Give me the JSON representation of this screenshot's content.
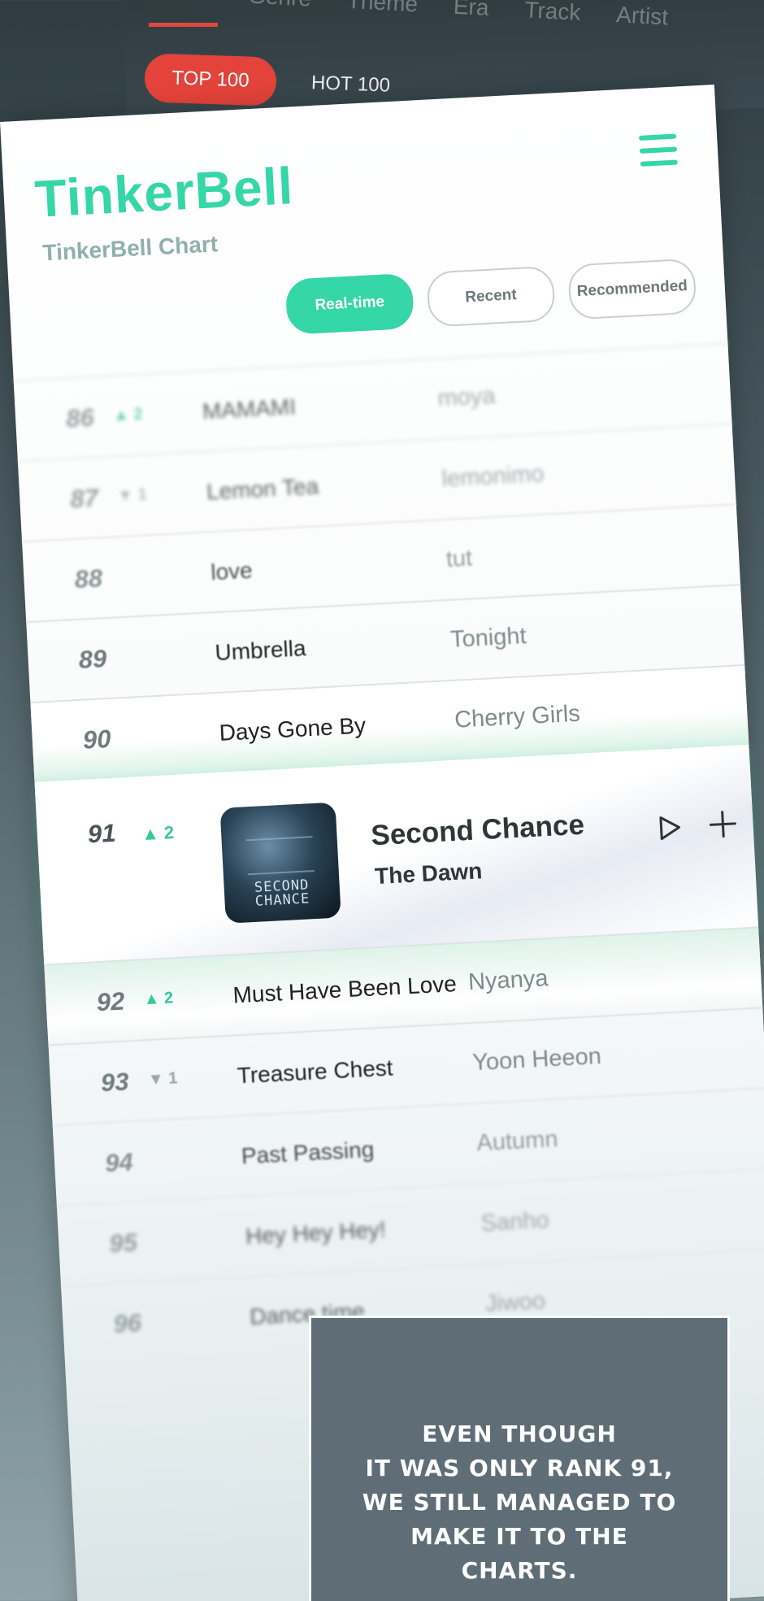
{
  "background_app": {
    "nav_items": [
      "Genre",
      "Theme",
      "Era",
      "Track",
      "Artist"
    ],
    "active_tab": "TOP 100",
    "other_tab": "HOT 100",
    "accent_color": "#e3433a"
  },
  "app": {
    "logo": "TinkerBell",
    "subtitle": "TinkerBell Chart",
    "brand_color": "#35d6a8",
    "menu_icon": "hamburger-menu-icon"
  },
  "tabs": [
    {
      "label": "Real-time",
      "active": true
    },
    {
      "label": "Recent",
      "active": false
    },
    {
      "label": "Recommended",
      "active": false
    }
  ],
  "chart": {
    "rows_before": [
      {
        "rank": "86",
        "delta": "▲ 2",
        "direction": "up",
        "title": "MAMAMI",
        "artist": "moya"
      },
      {
        "rank": "87",
        "delta": "▼ 1",
        "direction": "down",
        "title": "Lemon Tea",
        "artist": "lemonimo"
      },
      {
        "rank": "88",
        "delta": "",
        "direction": "none",
        "title": "love",
        "artist": "tut"
      },
      {
        "rank": "89",
        "delta": "",
        "direction": "none",
        "title": "Umbrella",
        "artist": "Tonight"
      },
      {
        "rank": "90",
        "delta": "",
        "direction": "none",
        "title": "Days Gone By",
        "artist": "Cherry Girls"
      }
    ],
    "featured": {
      "rank": "91",
      "delta": "▲ 2",
      "direction": "up",
      "title": "Second Chance",
      "artist": "The Dawn",
      "cover_text": "SECOND CHANCE",
      "play_icon": "play-icon",
      "add_icon": "plus-icon"
    },
    "rows_after": [
      {
        "rank": "92",
        "delta": "▲ 2",
        "direction": "up",
        "title": "Must Have Been Love",
        "artist": "Nyanya"
      },
      {
        "rank": "93",
        "delta": "▼ 1",
        "direction": "down",
        "title": "Treasure Chest",
        "artist": "Yoon Heeon"
      },
      {
        "rank": "94",
        "delta": "",
        "direction": "none",
        "title": "Past Passing",
        "artist": "Autumn"
      },
      {
        "rank": "95",
        "delta": "",
        "direction": "none",
        "title": "Hey Hey Hey!",
        "artist": "Sanho"
      },
      {
        "rank": "96",
        "delta": "",
        "direction": "none",
        "title": "Dance time",
        "artist": "Jiwoo"
      }
    ]
  },
  "caption": {
    "lines": [
      "EVEN THOUGH",
      "IT WAS ONLY RANK 91,",
      "WE STILL MANAGED TO",
      "MAKE IT TO THE",
      "CHARTS."
    ]
  }
}
